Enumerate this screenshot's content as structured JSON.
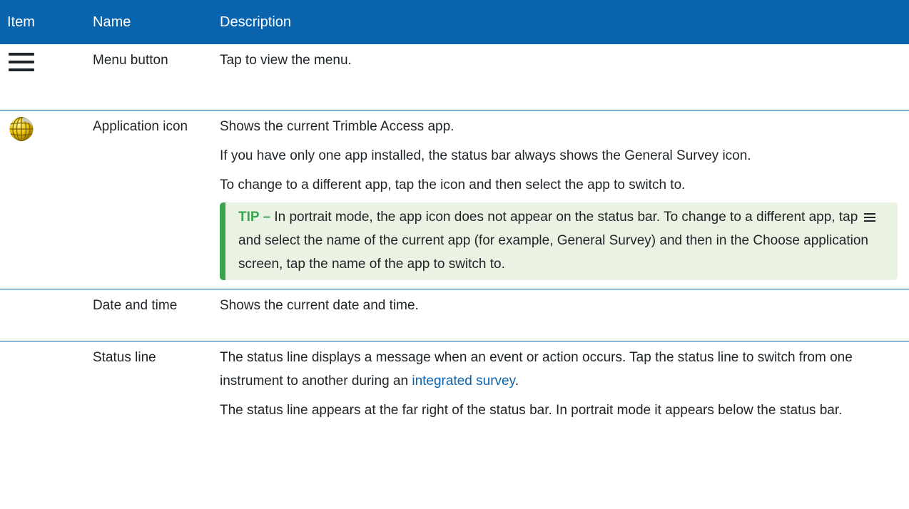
{
  "table": {
    "headers": {
      "item": "Item",
      "name": "Name",
      "description": "Description"
    },
    "rows": {
      "menu": {
        "icon": "hamburger-menu-icon",
        "name": "Menu button",
        "desc": "Tap to view the menu."
      },
      "app": {
        "icon": "globe-application-icon",
        "name": "Application icon",
        "desc1": "Shows the current Trimble Access app.",
        "desc2": "If you have only one app installed, the status bar always shows the General Survey icon.",
        "desc3": "To change to a different app, tap the icon and then select the app to switch to.",
        "tip": {
          "label": "TIP –",
          "t1": " In portrait mode, the app icon does not appear on the status bar. To change to a different app, tap ",
          "icon": "hamburger-menu-icon",
          "t2": " and select the name of the current app (for example, ",
          "b1": "General Survey",
          "t3": ") and then in the ",
          "b2": "Choose application",
          "t4": " screen, tap the name of the app to switch to."
        }
      },
      "date": {
        "name": "Date and time",
        "desc": "Shows the current date and time."
      },
      "status": {
        "name": "Status line",
        "desc1a": "The status line displays a message when an event or action occurs. Tap the status line to switch from one instrument to another during an ",
        "link": "integrated survey",
        "desc1b": ".",
        "desc2": "The status line appears at the far right of the status bar. In portrait mode it appears below the status bar."
      }
    }
  },
  "colors": {
    "header_bg": "#0a63ad",
    "tip_bg": "#eaf2e3",
    "tip_accent": "#3aa34c",
    "link": "#0a63ad"
  }
}
